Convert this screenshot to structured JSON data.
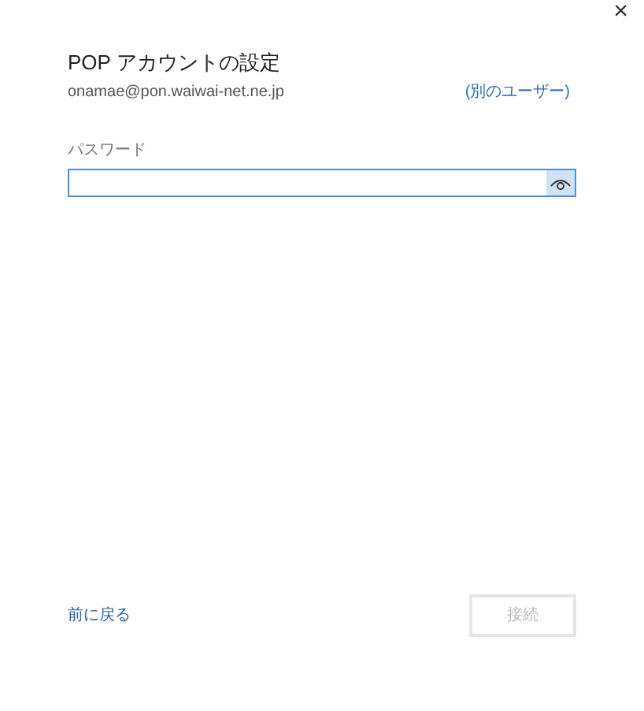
{
  "close": "×",
  "title": "POP アカウントの設定",
  "email": "onamae@pon.waiwai-net.ne.jp",
  "other_user_link": "(別のユーザー)",
  "password": {
    "label": "パスワード",
    "focused": true
  },
  "back_link": "前に戻る",
  "connect_button": {
    "label": "接続",
    "disabled": true
  }
}
